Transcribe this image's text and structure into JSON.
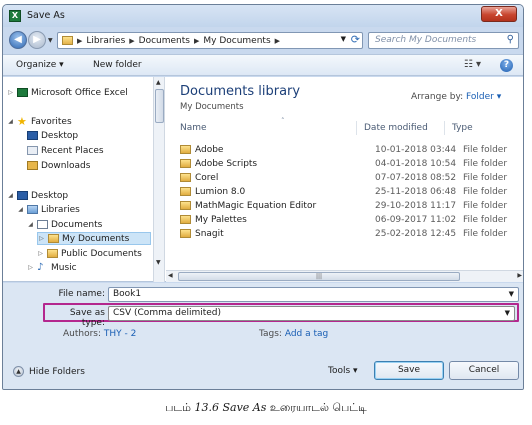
{
  "window": {
    "title": "Save As",
    "close_label": "X"
  },
  "address_bar": {
    "crumbs": [
      "Libraries",
      "Documents",
      "My Documents"
    ]
  },
  "search": {
    "placeholder": "Search My Documents"
  },
  "toolbar": {
    "organize": "Organize ▾",
    "new_folder": "New folder"
  },
  "nav_tree": [
    {
      "label": "Microsoft Office Excel",
      "icon": "excel-icon",
      "level": 0,
      "twisty": "▷"
    },
    {
      "label": "Favorites",
      "icon": "star-icon",
      "level": 0,
      "twisty": "◢"
    },
    {
      "label": "Desktop",
      "icon": "desktop-icon",
      "level": 1,
      "twisty": ""
    },
    {
      "label": "Recent Places",
      "icon": "recent-places-icon",
      "level": 1,
      "twisty": ""
    },
    {
      "label": "Downloads",
      "icon": "downloads-icon",
      "level": 1,
      "twisty": ""
    },
    {
      "label": "Desktop",
      "icon": "desktop-icon",
      "level": 0,
      "twisty": "◢"
    },
    {
      "label": "Libraries",
      "icon": "library-icon",
      "level": 1,
      "twisty": "◢"
    },
    {
      "label": "Documents",
      "icon": "document-icon",
      "level": 2,
      "twisty": "◢"
    },
    {
      "label": "My Documents",
      "icon": "folder-icon",
      "level": 3,
      "twisty": "▷"
    },
    {
      "label": "Public Documents",
      "icon": "folder-icon",
      "level": 3,
      "twisty": "▷"
    },
    {
      "label": "Music",
      "icon": "music-icon",
      "level": 2,
      "twisty": "▷"
    }
  ],
  "library": {
    "title": "Documents library",
    "subtitle": "My Documents",
    "arrange_label": "Arrange by:",
    "arrange_value": "Folder ▾"
  },
  "columns": {
    "name": "Name",
    "date": "Date modified",
    "type": "Type"
  },
  "files": [
    {
      "name": "Adobe",
      "date": "10-01-2018 03:44",
      "type": "File folder"
    },
    {
      "name": "Adobe Scripts",
      "date": "04-01-2018 10:54",
      "type": "File folder"
    },
    {
      "name": "Corel",
      "date": "07-07-2018 08:52",
      "type": "File folder"
    },
    {
      "name": "Lumion 8.0",
      "date": "25-11-2018 06:48",
      "type": "File folder"
    },
    {
      "name": "MathMagic Equation Editor",
      "date": "29-10-2018 11:17",
      "type": "File folder"
    },
    {
      "name": "My Palettes",
      "date": "06-09-2017 11:02",
      "type": "File folder"
    },
    {
      "name": "Snagit",
      "date": "25-02-2018 12:45",
      "type": "File folder"
    }
  ],
  "form": {
    "file_name_label": "File name:",
    "file_name_value": "Book1",
    "save_type_label": "Save as type:",
    "save_type_value": "CSV (Comma delimited)",
    "authors_label": "Authors:",
    "authors_value": "THY - 2",
    "tags_label": "Tags:",
    "tags_value": "Add a tag"
  },
  "footer": {
    "hide_folders": "Hide Folders",
    "tools": "Tools ▾",
    "save": "Save",
    "cancel": "Cancel"
  },
  "caption": {
    "prefix": "படம்",
    "number": "13.6 Save As",
    "suffix": "உரையாடல் பெட்டி"
  },
  "colors": {
    "highlight_border": "#b4278e",
    "link": "#1a5fb4",
    "selection": "#cce4f7"
  }
}
